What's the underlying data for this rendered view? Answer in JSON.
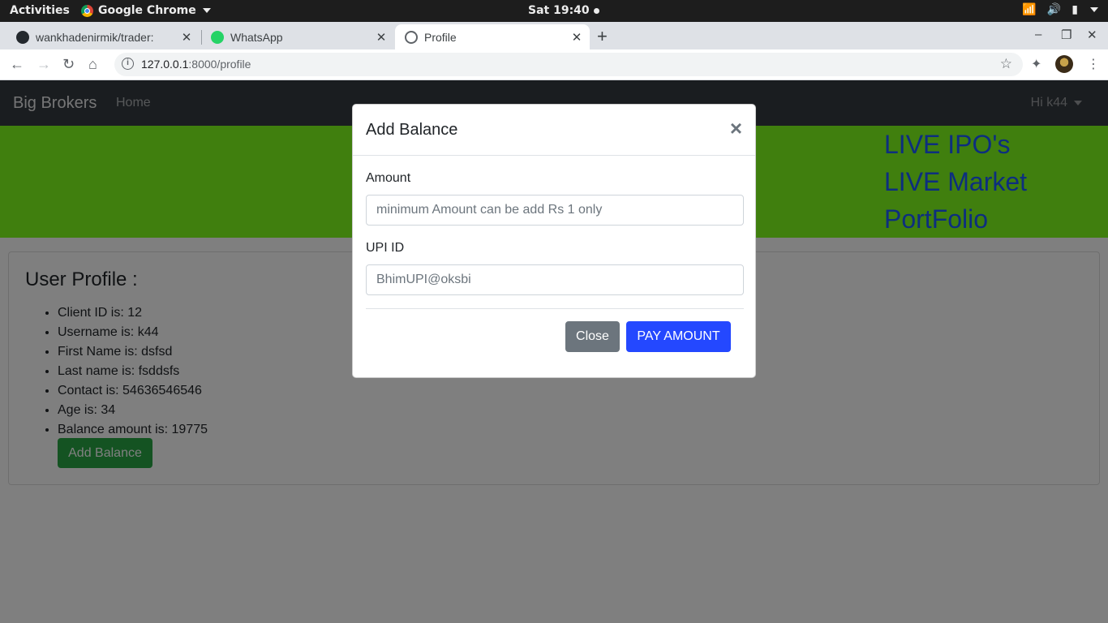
{
  "system": {
    "activities": "Activities",
    "app_name": "Google Chrome",
    "clock": "Sat 19:40"
  },
  "browser": {
    "tabs": [
      {
        "title": "wankhadenirmik/trader:",
        "icon": "github-icon"
      },
      {
        "title": "WhatsApp",
        "icon": "whatsapp-icon"
      },
      {
        "title": "Profile",
        "icon": "globe-icon"
      }
    ],
    "url_host": "127.0.0.1",
    "url_path": ":8000/profile"
  },
  "navbar": {
    "brand": "Big Brokers",
    "home": "Home",
    "user": "Hi k44"
  },
  "hero": {
    "links": [
      "LIVE IPO's",
      "LIVE Market",
      "PortFolio"
    ],
    "bg_color": "#80ff1c",
    "link_color": "#1a5cff"
  },
  "profile": {
    "heading": "User Profile :",
    "items": [
      "Client ID is: 12",
      "Username is: k44",
      "First Name is: dsfsd",
      "Last name is: fsddsfs",
      "Contact is: 54636546546",
      "Age is: 34",
      "Balance amount is: 19775"
    ],
    "add_balance_label": "Add Balance"
  },
  "modal": {
    "title": "Add Balance",
    "close_symbol": "×",
    "amount_label": "Amount",
    "amount_placeholder": "minimum Amount can be add Rs 1 only",
    "upi_label": "UPI ID",
    "upi_placeholder": "BhimUPI@oksbi",
    "close_label": "Close",
    "pay_label": "PAY AMOUNT"
  }
}
